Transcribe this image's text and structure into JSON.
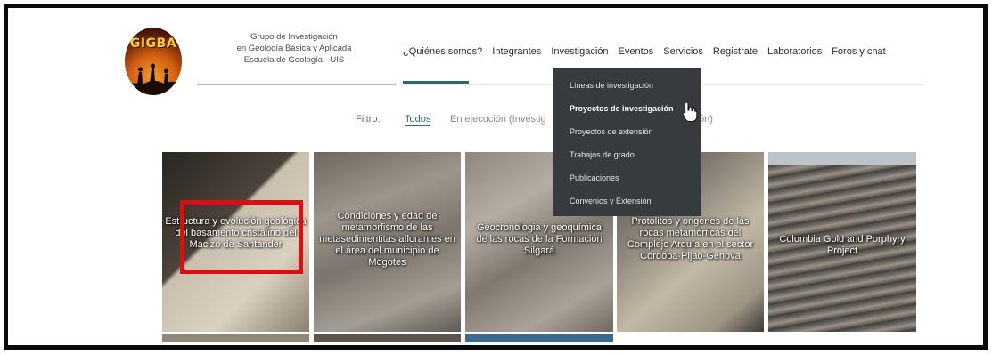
{
  "logo": {
    "text": "GIGBA"
  },
  "organization": {
    "line1": "Grupo de Investigación",
    "line2": "en Geología Básica y Aplicada",
    "line3": "Escuela de Geología - UIS"
  },
  "nav": [
    "¿Quiénes somos?",
    "Integrantes",
    "Investigación",
    "Eventos",
    "Servicios",
    "Registrate",
    "Laboratorios",
    "Foros y chat"
  ],
  "dropdown": {
    "items": [
      "Líneas de investigación",
      "Proyectos de investigación",
      "Proyectos de extensión",
      "Trabajos de grado",
      "Publicaciones",
      "Convenios y Extensión"
    ],
    "highlighted_index": 1
  },
  "filter": {
    "label": "Filtro:",
    "all": "Todos",
    "in_progress": "En ejecución (Investig",
    "in_progress_tail": "ón)"
  },
  "tiles": [
    "Estructura y evolución geológica del basamento cristalino del Macizo de Santander",
    "Condiciones y edad de metamorfismo de las metasedimentitas aflorantes en el área del municipio de Mogotes",
    "Geocronologia y geoquímica de las rocas de la Formación Silgará",
    "Protolitos y origenes de las rocas metamórficas del Complejo Arquía en el sector Cordoba-Pijao-Genova",
    "Colombia Gold and Porphyry Project"
  ],
  "colors": {
    "accent": "#2e6b6b",
    "dropdown_bg": "#373b3e",
    "highlight_box": "#d8100f"
  }
}
